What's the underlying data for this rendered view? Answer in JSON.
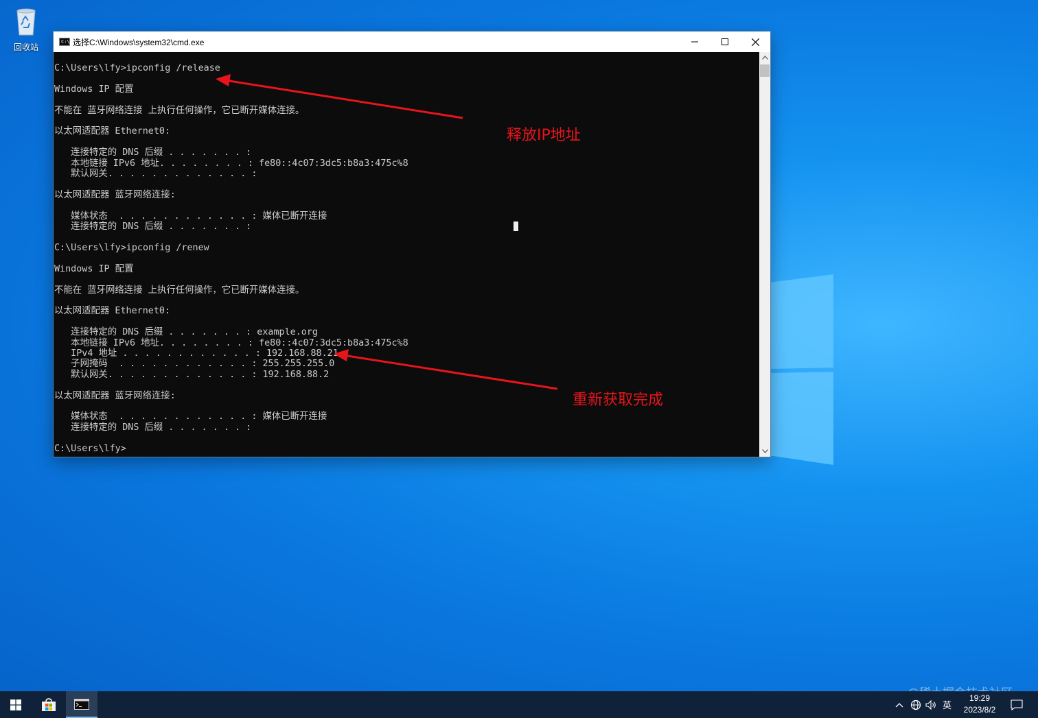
{
  "desktop": {
    "recycle_bin_label": "回收站"
  },
  "window": {
    "title": "选择C:\\Windows\\system32\\cmd.exe",
    "icon_text": "C:\\"
  },
  "console": {
    "text": "C:\\Users\\lfy>ipconfig /release\n\nWindows IP 配置\n\n不能在 蓝牙网络连接 上执行任何操作，它已断开媒体连接。\n\n以太网适配器 Ethernet0:\n\n   连接特定的 DNS 后缀 . . . . . . . :\n   本地链接 IPv6 地址. . . . . . . . : fe80::4c07:3dc5:b8a3:475c%8\n   默认网关. . . . . . . . . . . . . :\n\n以太网适配器 蓝牙网络连接:\n\n   媒体状态  . . . . . . . . . . . . : 媒体已断开连接\n   连接特定的 DNS 后缀 . . . . . . . :\n\nC:\\Users\\lfy>ipconfig /renew\n\nWindows IP 配置\n\n不能在 蓝牙网络连接 上执行任何操作，它已断开媒体连接。\n\n以太网适配器 Ethernet0:\n\n   连接特定的 DNS 后缀 . . . . . . . : example.org\n   本地链接 IPv6 地址. . . . . . . . : fe80::4c07:3dc5:b8a3:475c%8\n   IPv4 地址 . . . . . . . . . . . . : 192.168.88.21\n   子网掩码  . . . . . . . . . . . . : 255.255.255.0\n   默认网关. . . . . . . . . . . . . : 192.168.88.2\n\n以太网适配器 蓝牙网络连接:\n\n   媒体状态  . . . . . . . . . . . . : 媒体已断开连接\n   连接特定的 DNS 后缀 . . . . . . . :\n\nC:\\Users\\lfy>"
  },
  "annotations": {
    "release": "释放IP地址",
    "renew": "重新获取完成",
    "color": "#e8141c"
  },
  "taskbar": {
    "tray_language": "英",
    "clock_time": "19:29",
    "clock_date": "2023/8/2"
  },
  "watermark": "@稀土掘金技术社区",
  "colors": {
    "console_bg": "#0c0c0c",
    "console_fg": "#cccccc",
    "taskbar_bg": "#10223a",
    "desktop_accent": "#0a78df"
  }
}
